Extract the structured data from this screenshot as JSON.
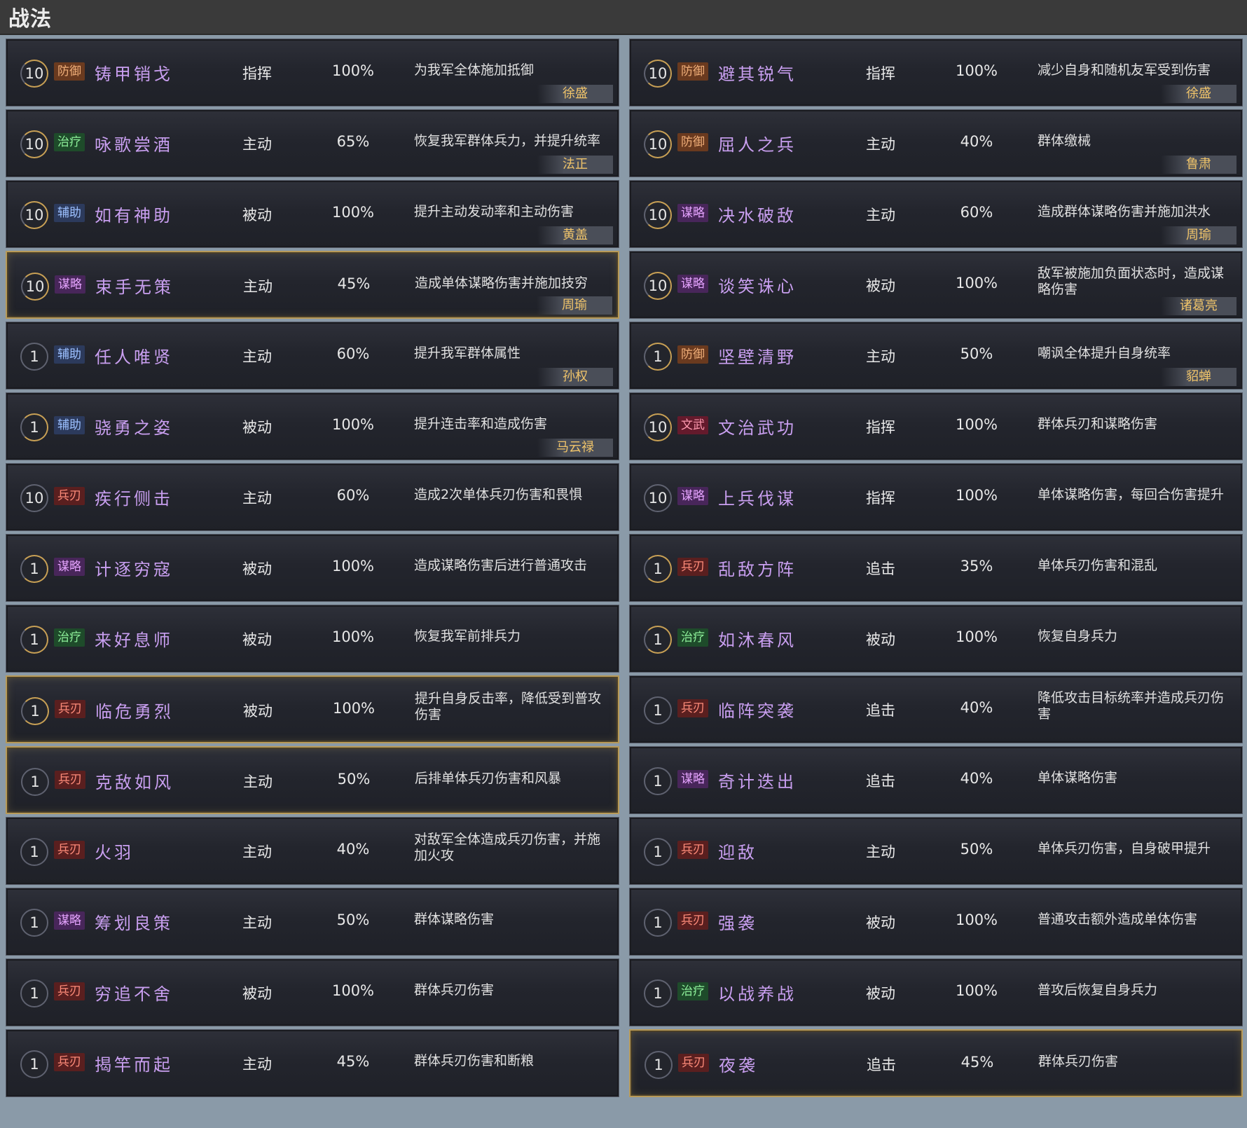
{
  "header": {
    "title": "战法"
  },
  "colors": {
    "defense": "#f2b07a",
    "heal": "#8ef09a",
    "assist": "#9cc0ff",
    "strategy": "#e6a4ff",
    "blade": "#ff8c7a",
    "civil_martial": "#ff9ab0",
    "hero": "#f0c46a",
    "highlight_border": "#b89a58"
  },
  "left": [
    {
      "level": "10",
      "tag": "防御",
      "name": "铸甲销戈",
      "type": "指挥",
      "rate": "100%",
      "desc": "为我军全体施加抵御",
      "hero": "徐盛"
    },
    {
      "level": "10",
      "tag": "治疗",
      "name": "咏歌尝酒",
      "type": "主动",
      "rate": "65%",
      "desc": "恢复我军群体兵力，并提升统率",
      "hero": "法正"
    },
    {
      "level": "10",
      "tag": "辅助",
      "name": "如有神助",
      "type": "被动",
      "rate": "100%",
      "desc": "提升主动发动率和主动伤害",
      "hero": "黄盖"
    },
    {
      "level": "10",
      "tag": "谋略",
      "name": "束手无策",
      "type": "主动",
      "rate": "45%",
      "desc": "造成单体谋略伤害并施加技穷",
      "hero": "周瑜"
    },
    {
      "level": "1",
      "tag": "辅助",
      "name": "任人唯贤",
      "type": "主动",
      "rate": "60%",
      "desc": "提升我军群体属性",
      "hero": "孙权"
    },
    {
      "level": "1",
      "tag": "辅助",
      "name": "骁勇之姿",
      "type": "被动",
      "rate": "100%",
      "desc": "提升连击率和造成伤害",
      "hero": "马云禄"
    },
    {
      "level": "10",
      "tag": "兵刃",
      "name": "疾行侧击",
      "type": "主动",
      "rate": "60%",
      "desc": "造成2次单体兵刃伤害和畏惧",
      "hero": ""
    },
    {
      "level": "1",
      "tag": "谋略",
      "name": "计逐穷寇",
      "type": "被动",
      "rate": "100%",
      "desc": "造成谋略伤害后进行普通攻击",
      "hero": ""
    },
    {
      "level": "1",
      "tag": "治疗",
      "name": "来好息师",
      "type": "被动",
      "rate": "100%",
      "desc": "恢复我军前排兵力",
      "hero": ""
    },
    {
      "level": "1",
      "tag": "兵刃",
      "name": "临危勇烈",
      "type": "被动",
      "rate": "100%",
      "desc": "提升自身反击率，降低受到普攻伤害",
      "hero": ""
    },
    {
      "level": "1",
      "tag": "兵刃",
      "name": "克敌如风",
      "type": "主动",
      "rate": "50%",
      "desc": "后排单体兵刃伤害和风暴",
      "hero": ""
    },
    {
      "level": "1",
      "tag": "兵刃",
      "name": "火羽",
      "type": "主动",
      "rate": "40%",
      "desc": "对敌军全体造成兵刃伤害，并施加火攻",
      "hero": ""
    },
    {
      "level": "1",
      "tag": "谋略",
      "name": "筹划良策",
      "type": "主动",
      "rate": "50%",
      "desc": "群体谋略伤害",
      "hero": ""
    },
    {
      "level": "1",
      "tag": "兵刃",
      "name": "穷追不舍",
      "type": "被动",
      "rate": "100%",
      "desc": "群体兵刃伤害",
      "hero": ""
    },
    {
      "level": "1",
      "tag": "兵刃",
      "name": "揭竿而起",
      "type": "主动",
      "rate": "45%",
      "desc": "群体兵刃伤害和断粮",
      "hero": ""
    }
  ],
  "right": [
    {
      "level": "10",
      "tag": "防御",
      "name": "避其锐气",
      "type": "指挥",
      "rate": "100%",
      "desc": "减少自身和随机友军受到伤害",
      "hero": "徐盛"
    },
    {
      "level": "10",
      "tag": "防御",
      "name": "屈人之兵",
      "type": "主动",
      "rate": "40%",
      "desc": "群体缴械",
      "hero": "鲁肃"
    },
    {
      "level": "10",
      "tag": "谋略",
      "name": "决水破敌",
      "type": "主动",
      "rate": "60%",
      "desc": "造成群体谋略伤害并施加洪水",
      "hero": "周瑜"
    },
    {
      "level": "10",
      "tag": "谋略",
      "name": "谈笑诛心",
      "type": "被动",
      "rate": "100%",
      "desc": "敌军被施加负面状态时，造成谋略伤害",
      "hero": "诸葛亮"
    },
    {
      "level": "1",
      "tag": "防御",
      "name": "坚壁清野",
      "type": "主动",
      "rate": "50%",
      "desc": "嘲讽全体提升自身统率",
      "hero": "貂蝉"
    },
    {
      "level": "10",
      "tag": "文武",
      "name": "文治武功",
      "type": "指挥",
      "rate": "100%",
      "desc": "群体兵刃和谋略伤害",
      "hero": ""
    },
    {
      "level": "10",
      "tag": "谋略",
      "name": "上兵伐谋",
      "type": "指挥",
      "rate": "100%",
      "desc": "单体谋略伤害，每回合伤害提升",
      "hero": ""
    },
    {
      "level": "1",
      "tag": "兵刃",
      "name": "乱敌方阵",
      "type": "追击",
      "rate": "35%",
      "desc": "单体兵刃伤害和混乱",
      "hero": ""
    },
    {
      "level": "1",
      "tag": "治疗",
      "name": "如沐春风",
      "type": "被动",
      "rate": "100%",
      "desc": "恢复自身兵力",
      "hero": ""
    },
    {
      "level": "1",
      "tag": "兵刃",
      "name": "临阵突袭",
      "type": "追击",
      "rate": "40%",
      "desc": "降低攻击目标统率并造成兵刃伤害",
      "hero": ""
    },
    {
      "level": "1",
      "tag": "谋略",
      "name": "奇计迭出",
      "type": "追击",
      "rate": "40%",
      "desc": "单体谋略伤害",
      "hero": ""
    },
    {
      "level": "1",
      "tag": "兵刃",
      "name": "迎敌",
      "type": "主动",
      "rate": "50%",
      "desc": "单体兵刃伤害，自身破甲提升",
      "hero": ""
    },
    {
      "level": "1",
      "tag": "兵刃",
      "name": "强袭",
      "type": "被动",
      "rate": "100%",
      "desc": "普通攻击额外造成单体伤害",
      "hero": ""
    },
    {
      "level": "1",
      "tag": "治疗",
      "name": "以战养战",
      "type": "被动",
      "rate": "100%",
      "desc": "普攻后恢复自身兵力",
      "hero": ""
    },
    {
      "level": "1",
      "tag": "兵刃",
      "name": "夜袭",
      "type": "追击",
      "rate": "45%",
      "desc": "群体兵刃伤害",
      "hero": ""
    }
  ]
}
